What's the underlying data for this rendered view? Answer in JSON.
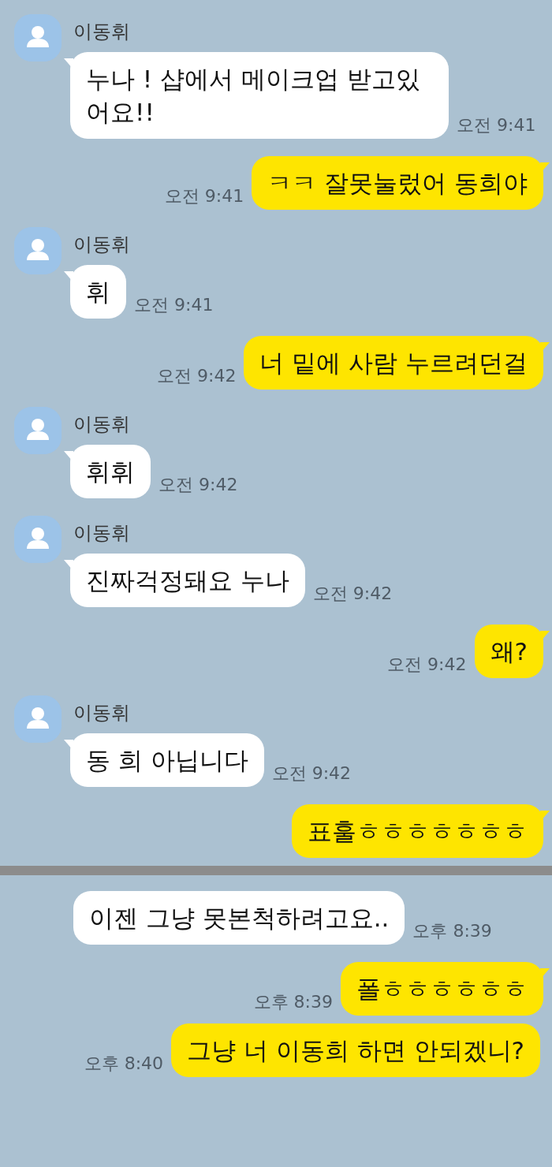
{
  "messages": [
    {
      "kind": "in",
      "sender": "이동휘",
      "text": "누나 ! 샵에서 메이크업 받고있어요!!",
      "time": "오전 9:41",
      "tail": true
    },
    {
      "kind": "out",
      "text": "ㅋㅋ 잘못눌렀어 동희야",
      "time": "오전 9:41",
      "tail": true
    },
    {
      "kind": "in",
      "sender": "이동휘",
      "text": "휘",
      "time": "오전 9:41",
      "tail": true
    },
    {
      "kind": "out",
      "text": "너 밑에 사람 누르려던걸",
      "time": "오전 9:42",
      "tail": true
    },
    {
      "kind": "in",
      "sender": "이동휘",
      "text": "휘휘",
      "time": "오전 9:42",
      "tail": true
    },
    {
      "kind": "in",
      "sender": "이동휘",
      "text": "진짜걱정돼요 누나",
      "time": "오전 9:42",
      "tail": true
    },
    {
      "kind": "out",
      "text": "왜?",
      "time": "오전 9:42",
      "tail": true
    },
    {
      "kind": "in",
      "sender": "이동휘",
      "text": "동 희 아닙니다",
      "time": "오전 9:42",
      "tail": true
    },
    {
      "kind": "out",
      "text": "표훌ㅎㅎㅎㅎㅎㅎㅎ",
      "tail": true
    },
    {
      "kind": "divider"
    },
    {
      "kind": "in",
      "text": "이젠 그냥 못본척하려고요..",
      "time": "오후 8:39",
      "tail": false
    },
    {
      "kind": "out",
      "text": "폴ㅎㅎㅎㅎㅎㅎ",
      "time": "오후 8:39",
      "tail": true
    },
    {
      "kind": "out",
      "text": "그냥 너 이동희 하면 안되겠니?",
      "time": "오후 8:40",
      "tail": false
    }
  ]
}
